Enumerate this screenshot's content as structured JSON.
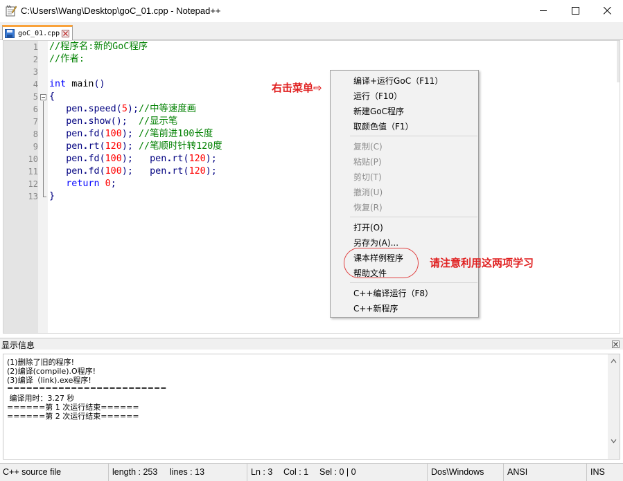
{
  "window": {
    "title": "C:\\Users\\Wang\\Desktop\\goC_01.cpp - Notepad++"
  },
  "tabs": [
    {
      "label": "goC_01.cpp",
      "active": true
    }
  ],
  "editor": {
    "line_numbers": [
      "1",
      "2",
      "3",
      "4",
      "5",
      "6",
      "7",
      "8",
      "9",
      "10",
      "11",
      "12",
      "13"
    ],
    "lines": [
      [
        {
          "c": "cm",
          "t": "//程序名:新的GoC程序"
        }
      ],
      [
        {
          "c": "cm",
          "t": "//作者:"
        }
      ],
      [],
      [
        {
          "c": "kw",
          "t": "int"
        },
        {
          "c": "",
          "t": " main"
        },
        {
          "c": "pn",
          "t": "()"
        }
      ],
      [
        {
          "c": "pn",
          "t": "{"
        }
      ],
      [
        {
          "c": "",
          "t": "   "
        },
        {
          "c": "fn",
          "t": "pen"
        },
        {
          "c": "op",
          "t": "."
        },
        {
          "c": "fn",
          "t": "speed"
        },
        {
          "c": "pn",
          "t": "("
        },
        {
          "c": "nm",
          "t": "5"
        },
        {
          "c": "pn",
          "t": ");"
        },
        {
          "c": "cm",
          "t": "//中等速度画"
        }
      ],
      [
        {
          "c": "",
          "t": "   "
        },
        {
          "c": "fn",
          "t": "pen"
        },
        {
          "c": "op",
          "t": "."
        },
        {
          "c": "fn",
          "t": "show"
        },
        {
          "c": "pn",
          "t": "();"
        },
        {
          "c": "",
          "t": "  "
        },
        {
          "c": "cm",
          "t": "//显示笔"
        }
      ],
      [
        {
          "c": "",
          "t": "   "
        },
        {
          "c": "fn",
          "t": "pen"
        },
        {
          "c": "op",
          "t": "."
        },
        {
          "c": "fn",
          "t": "fd"
        },
        {
          "c": "pn",
          "t": "("
        },
        {
          "c": "nm",
          "t": "100"
        },
        {
          "c": "pn",
          "t": ");"
        },
        {
          "c": "",
          "t": " "
        },
        {
          "c": "cm",
          "t": "//笔前进100长度"
        }
      ],
      [
        {
          "c": "",
          "t": "   "
        },
        {
          "c": "fn",
          "t": "pen"
        },
        {
          "c": "op",
          "t": "."
        },
        {
          "c": "fn",
          "t": "rt"
        },
        {
          "c": "pn",
          "t": "("
        },
        {
          "c": "nm",
          "t": "120"
        },
        {
          "c": "pn",
          "t": ");"
        },
        {
          "c": "",
          "t": " "
        },
        {
          "c": "cm",
          "t": "//笔顺时针转120度"
        }
      ],
      [
        {
          "c": "",
          "t": "   "
        },
        {
          "c": "fn",
          "t": "pen"
        },
        {
          "c": "op",
          "t": "."
        },
        {
          "c": "fn",
          "t": "fd"
        },
        {
          "c": "pn",
          "t": "("
        },
        {
          "c": "nm",
          "t": "100"
        },
        {
          "c": "pn",
          "t": ");"
        },
        {
          "c": "",
          "t": "   "
        },
        {
          "c": "fn",
          "t": "pen"
        },
        {
          "c": "op",
          "t": "."
        },
        {
          "c": "fn",
          "t": "rt"
        },
        {
          "c": "pn",
          "t": "("
        },
        {
          "c": "nm",
          "t": "120"
        },
        {
          "c": "pn",
          "t": ");"
        }
      ],
      [
        {
          "c": "",
          "t": "   "
        },
        {
          "c": "fn",
          "t": "pen"
        },
        {
          "c": "op",
          "t": "."
        },
        {
          "c": "fn",
          "t": "fd"
        },
        {
          "c": "pn",
          "t": "("
        },
        {
          "c": "nm",
          "t": "100"
        },
        {
          "c": "pn",
          "t": ");"
        },
        {
          "c": "",
          "t": "   "
        },
        {
          "c": "fn",
          "t": "pen"
        },
        {
          "c": "op",
          "t": "."
        },
        {
          "c": "fn",
          "t": "rt"
        },
        {
          "c": "pn",
          "t": "("
        },
        {
          "c": "nm",
          "t": "120"
        },
        {
          "c": "pn",
          "t": ");"
        }
      ],
      [
        {
          "c": "",
          "t": "   "
        },
        {
          "c": "kw",
          "t": "return"
        },
        {
          "c": "",
          "t": " "
        },
        {
          "c": "nm",
          "t": "0"
        },
        {
          "c": "pn",
          "t": ";"
        }
      ],
      [
        {
          "c": "pn",
          "t": "}"
        }
      ]
    ]
  },
  "annotations": {
    "right_click_menu": "右击菜单⇨",
    "note": "请注意利用这两项学习"
  },
  "context_menu": {
    "items": [
      {
        "label": "编译+运行GoC（F11）",
        "enabled": true
      },
      {
        "label": "运行（F10）",
        "enabled": true
      },
      {
        "label": "新建GoC程序",
        "enabled": true
      },
      {
        "label": "取颜色值（F1）",
        "enabled": true
      },
      {
        "label": "复制(C)",
        "enabled": false
      },
      {
        "label": "粘贴(P)",
        "enabled": false
      },
      {
        "label": "剪切(T)",
        "enabled": false
      },
      {
        "label": "撤消(U)",
        "enabled": false
      },
      {
        "label": "恢复(R)",
        "enabled": false
      },
      {
        "label": "打开(O)",
        "enabled": true
      },
      {
        "label": "另存为(A)...",
        "enabled": true
      },
      {
        "label": "课本样例程序",
        "enabled": true
      },
      {
        "label": "帮助文件",
        "enabled": true
      },
      {
        "label": "C++编译运行（F8）",
        "enabled": true
      },
      {
        "label": "C++新程序",
        "enabled": true
      }
    ]
  },
  "output_panel": {
    "title": "显示信息",
    "lines": [
      "(1)删除了旧的程序!",
      "(2)编译(compile).O程序!",
      "(3)编译（link).exe程序!",
      "=========================",
      " 编译用时：3.27 秒",
      "======第 1 次运行结束======",
      "======第 2 次运行结束======"
    ]
  },
  "status_bar": {
    "file_type": "C++ source file",
    "length": "length : 253",
    "lines": "lines : 13",
    "ln": "Ln : 3",
    "col": "Col : 1",
    "sel": "Sel : 0 | 0",
    "eol": "Dos\\Windows",
    "encoding": "ANSI",
    "mode": "INS"
  },
  "colors": {
    "comment": "#008000",
    "keyword": "#0000ff",
    "number": "#ff0000",
    "identifier": "#000080",
    "annotation": "#e02020",
    "tab_accent": "#f9a23b"
  }
}
